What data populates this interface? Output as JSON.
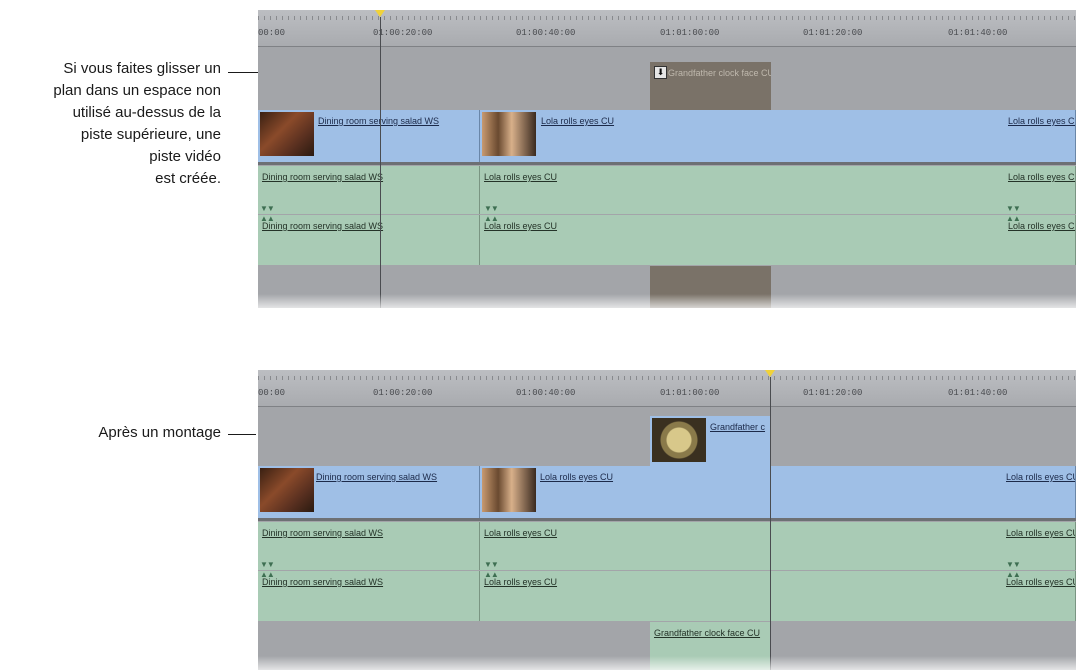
{
  "callouts": {
    "top": [
      "Si vous faites glisser un",
      "plan dans un espace non",
      "utilisé au-dessus de la",
      "piste supérieure, une",
      "piste vidéo",
      "est créée."
    ],
    "bottom": "Après un montage"
  },
  "ruler": {
    "timecodes": [
      "00:00",
      "01:00:20:00",
      "01:00:40:00",
      "01:01:00:00",
      "01:01:20:00",
      "01:01:40:00"
    ]
  },
  "clips": {
    "dining_video": "Dining room serving salad WS",
    "lola_video": "Lola rolls eyes CU",
    "dining_audio": "Dining room serving salad WS",
    "lola_audio": "Lola rolls eyes CU",
    "grandfather_ghost": "Grandfather clock face CU",
    "grandfather_video": "Grandfather c",
    "grandfather_audio": "Grandfather clock face CU"
  },
  "colors": {
    "video_clip": "#9fbfe6",
    "audio_clip": "#a9cbb5",
    "track_background": "#a3a5a9",
    "playhead_marker": "#f0d23a"
  },
  "icons": {
    "drop_indicator": "insert-arrow-icon",
    "keyframe": "audio-keyframe-icon"
  }
}
